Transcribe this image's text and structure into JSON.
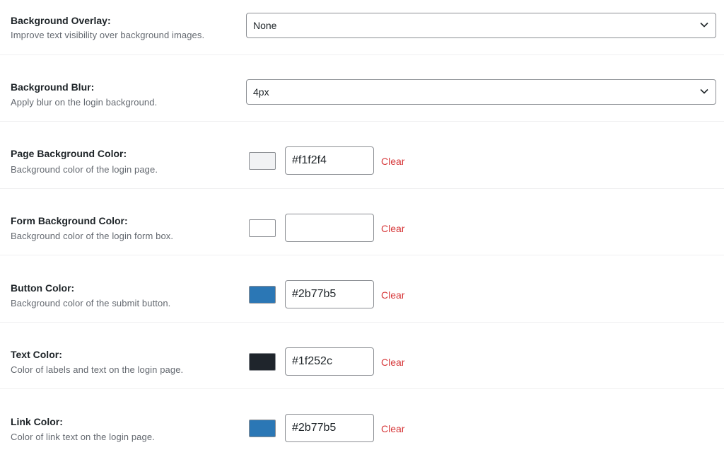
{
  "settings": {
    "background_overlay": {
      "label": "Background Overlay:",
      "description": "Improve text visibility over background images.",
      "selected": "None"
    },
    "background_blur": {
      "label": "Background Blur:",
      "description": "Apply blur on the login background.",
      "selected": "4px"
    },
    "page_background_color": {
      "label": "Page Background Color:",
      "description": "Background color of the login page.",
      "value": "#f1f2f4",
      "swatch": "#f1f2f4",
      "clear_label": "Clear"
    },
    "form_background_color": {
      "label": "Form Background Color:",
      "description": "Background color of the login form box.",
      "value": "",
      "swatch": "#ffffff",
      "clear_label": "Clear"
    },
    "button_color": {
      "label": "Button Color:",
      "description": "Background color of the submit button.",
      "value": "#2b77b5",
      "swatch": "#2b77b5",
      "clear_label": "Clear"
    },
    "text_color": {
      "label": "Text Color:",
      "description": "Color of labels and text on the login page.",
      "value": "#1f252c",
      "swatch": "#1f252c",
      "clear_label": "Clear"
    },
    "link_color": {
      "label": "Link Color:",
      "description": "Color of link text on the login page.",
      "value": "#2b77b5",
      "swatch": "#2b77b5",
      "clear_label": "Clear"
    }
  },
  "icons": {
    "select_arrow": "chevron-down-icon"
  },
  "colors": {
    "clear_link": "#d63638",
    "description_text": "#646970",
    "label_text": "#1d2327",
    "border": "#8c8f94"
  }
}
